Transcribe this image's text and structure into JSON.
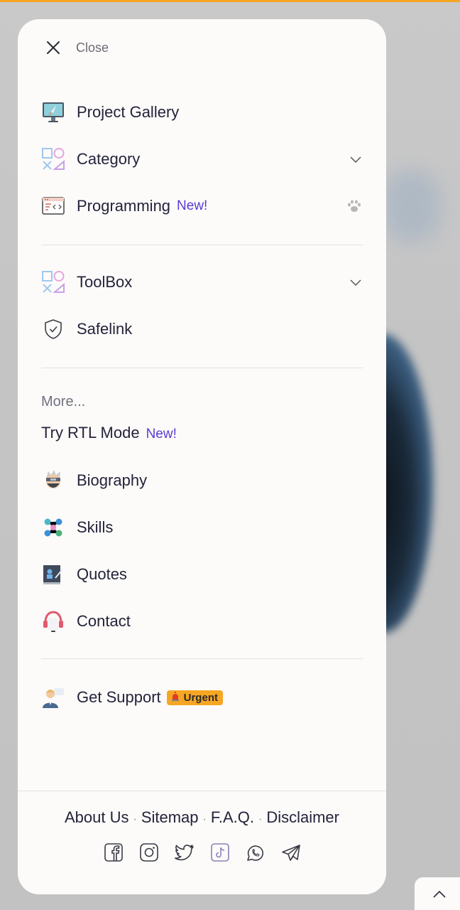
{
  "menu": {
    "close_label": "Close",
    "items": [
      {
        "label": "Project Gallery",
        "icon": "rocket-monitor-icon"
      },
      {
        "label": "Category",
        "icon": "shapes-icon",
        "chevron": true
      },
      {
        "label": "Programming",
        "icon": "code-window-icon",
        "badge": "New!",
        "trailing_icon": "paw-icon"
      },
      {
        "label": "ToolBox",
        "icon": "shapes-icon",
        "chevron": true
      },
      {
        "label": "Safelink",
        "icon": "shield-check-icon"
      }
    ],
    "more_label": "More...",
    "rtl": {
      "label": "Try RTL Mode",
      "badge": "New!"
    },
    "more_items": [
      {
        "label": "Biography",
        "icon": "ninja-avatar-icon"
      },
      {
        "label": "Skills",
        "icon": "skills-network-icon"
      },
      {
        "label": "Quotes",
        "icon": "quote-board-icon"
      },
      {
        "label": "Contact",
        "icon": "headset-icon"
      }
    ],
    "support": {
      "label": "Get Support",
      "badge": "Urgent",
      "badge_icon": "siren-icon"
    }
  },
  "footer": {
    "links": [
      "About Us",
      "Sitemap",
      "F.A.Q.",
      "Disclaimer"
    ],
    "separator": "·",
    "social": [
      "facebook-icon",
      "instagram-icon",
      "twitter-icon",
      "tiktok-icon",
      "whatsapp-icon",
      "telegram-icon"
    ]
  },
  "colors": {
    "accent": "#5b3bd1",
    "urgent": "#f6a623",
    "text": "#24233a",
    "panel": "#fcfbf9"
  }
}
